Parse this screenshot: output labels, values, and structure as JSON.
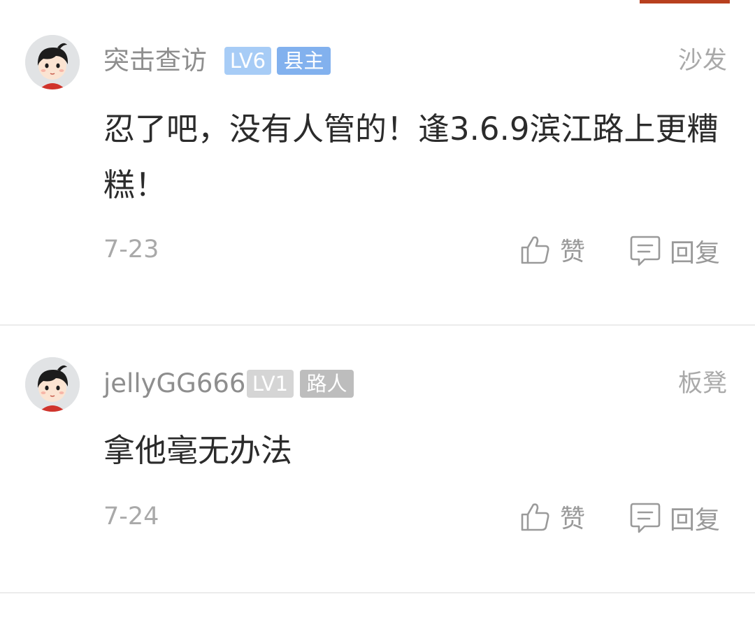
{
  "comments": [
    {
      "username": "突击查访",
      "level": "LV6",
      "rank": "县主",
      "floor": "沙发",
      "content": "忍了吧，没有人管的！逢3.6.9滨江路上更糟糕！",
      "date": "7-23",
      "like_label": "赞",
      "reply_label": "回复"
    },
    {
      "username": "jellyGG666",
      "level": "LV1",
      "rank": "路人",
      "floor": "板凳",
      "content": "拿他毫无办法",
      "date": "7-24",
      "like_label": "赞",
      "reply_label": "回复"
    }
  ],
  "colors": {
    "accent": "#b8401f",
    "lv6_badge": "#a7ccf6",
    "rank_blue": "#82b1ee",
    "lv1_badge": "#d5d5d5",
    "rank_gray": "#bdbdbd",
    "meta_text": "#a9a9a9",
    "content_text": "#2b2b2b"
  },
  "icons": {
    "avatar": "cartoon-avatar",
    "like": "thumbs-up-icon",
    "reply": "comment-bubble-icon"
  }
}
